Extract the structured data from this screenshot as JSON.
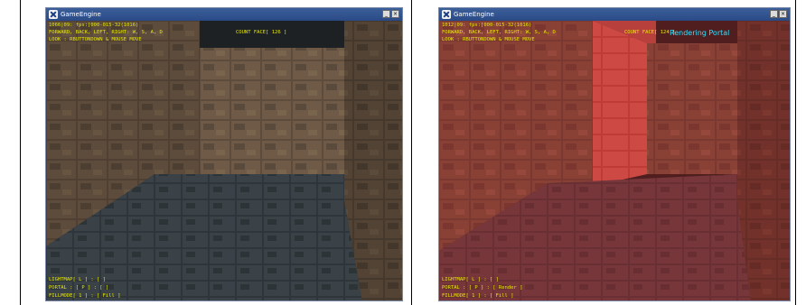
{
  "panels": [
    {
      "title": "GameEngine",
      "hud_top": [
        "1066|09: fps:[000-015-32(1016)",
        "FORWARD, BACK, LEFT, RIGHT: W, S, A, D",
        "LOOK : RBUTTONDOWN & MOUSE MOVE"
      ],
      "count_faces": "COUNT FACE[ 126 ]",
      "hud_bottom": [
        "LIGHTMAP[ L ] : [ ]",
        "PORTAL : [ P ] : [ ]",
        "FILLMODE[ 1 ] : [ Fill ]"
      ],
      "portal_label": ""
    },
    {
      "title": "GameEngine",
      "hud_top": [
        "1012|09: fps:[000-015-32(1016)",
        "FORWARD, BACK, LEFT, RIGHT: W, S, A, D",
        "LOOK : RBUTTONDOWN & MOUSE MOVE"
      ],
      "count_faces": "COUNT FACE[ 124 ]",
      "hud_bottom": [
        "LIGHTMAP[ L ] : [ ]",
        "PORTAL : [ P ] : [ Render ]",
        "FILLMODE[ 1 ] : [ Fill ]"
      ],
      "portal_label": "Rendering Portal"
    }
  ],
  "colors": {
    "hud": "#e6e600",
    "portal_label": "#33e0ff",
    "portal_tint": "#ff3030"
  }
}
